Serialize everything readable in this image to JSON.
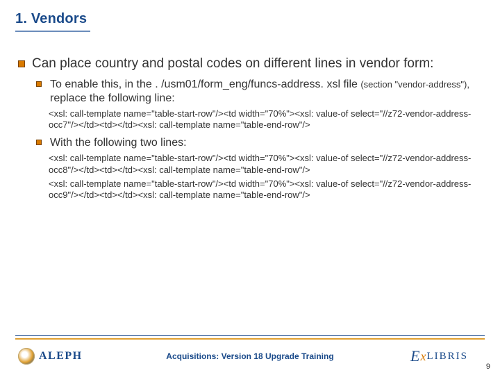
{
  "title": "1. Vendors",
  "bullets": {
    "main": "Can place country and postal codes on different lines in vendor form:",
    "sub1_a": "To enable this, in the . /usm01/form_eng/funcs-address. xsl file ",
    "sub1_section": "(section \"vendor-address\"), ",
    "sub1_b": "replace the following line:",
    "sub2": "With the following two lines:"
  },
  "code": {
    "block1": "<xsl: call-template name=\"table-start-row\"/><td width=\"70%\"><xsl: value-of select=\"//z72-vendor-address-occ7\"/></td><td></td><xsl: call-template name=\"table-end-row\"/>",
    "block2a": "<xsl: call-template name=\"table-start-row\"/><td width=\"70%\"><xsl: value-of select=\"//z72-vendor-address-occ8\"/></td><td></td><xsl: call-template name=\"table-end-row\"/>",
    "block2b": "<xsl: call-template name=\"table-start-row\"/><td width=\"70%\"><xsl: value-of select=\"//z72-vendor-address-occ9\"/></td><td></td><xsl: call-template name=\"table-end-row\"/>"
  },
  "footer": {
    "left_logo": "ALEPH",
    "caption": "Acquisitions: Version 18 Upgrade Training",
    "right_logo": {
      "e": "E",
      "x": "x",
      "rest": "Libris"
    },
    "page": "9"
  }
}
